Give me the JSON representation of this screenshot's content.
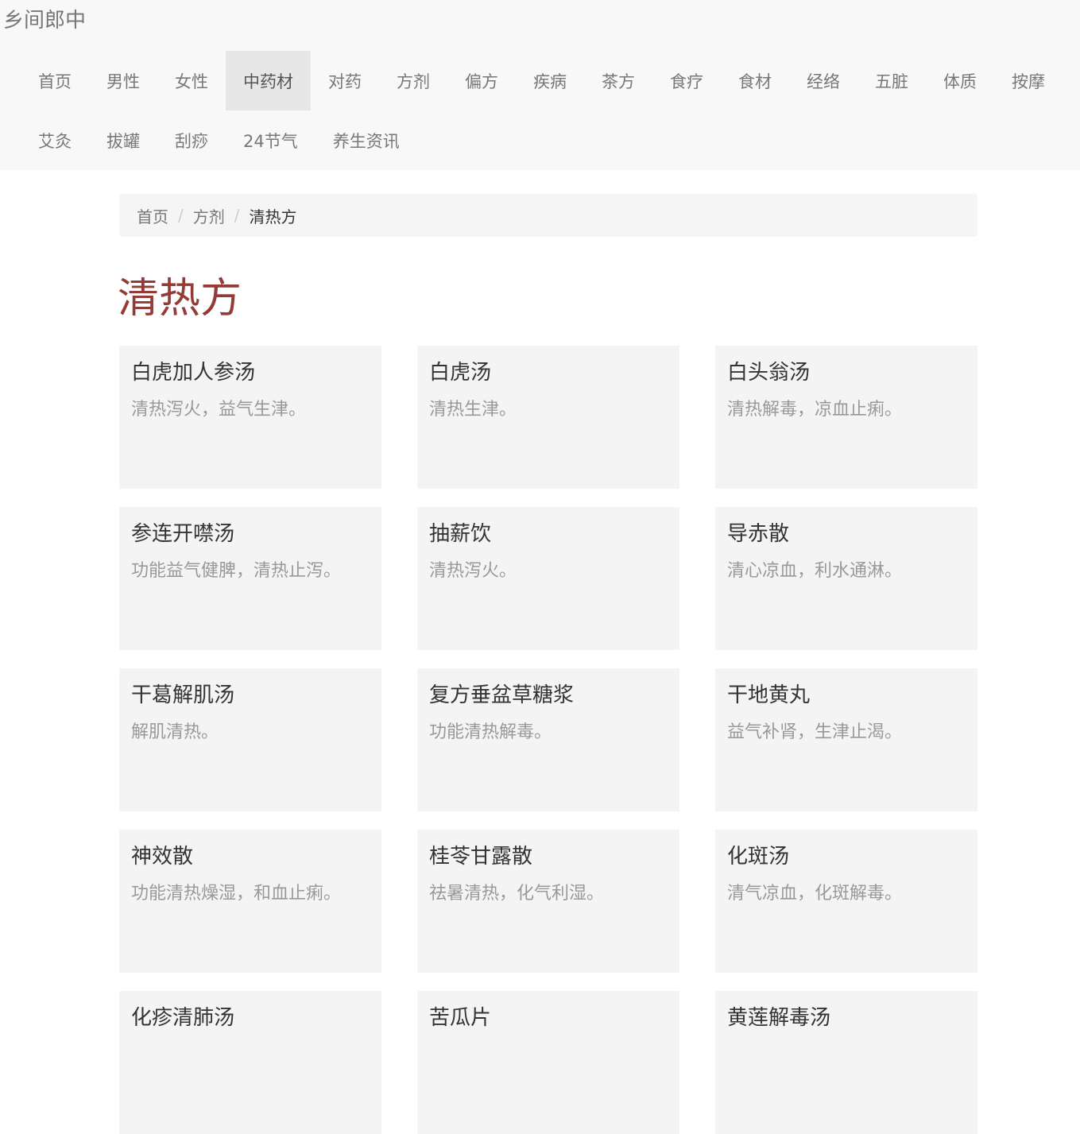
{
  "navbar": {
    "brand": "乡间郎中",
    "items": [
      {
        "label": "首页"
      },
      {
        "label": "男性"
      },
      {
        "label": "女性"
      },
      {
        "label": "中药材"
      },
      {
        "label": "对药"
      },
      {
        "label": "方剂"
      },
      {
        "label": "偏方"
      },
      {
        "label": "疾病"
      },
      {
        "label": "茶方"
      },
      {
        "label": "食疗"
      },
      {
        "label": "食材"
      },
      {
        "label": "经络"
      },
      {
        "label": "五脏"
      },
      {
        "label": "体质"
      },
      {
        "label": "按摩"
      },
      {
        "label": "艾灸"
      },
      {
        "label": "拔罐"
      },
      {
        "label": "刮痧"
      },
      {
        "label": "24节气"
      },
      {
        "label": "养生资讯"
      }
    ],
    "active_item": "中药材"
  },
  "breadcrumb": {
    "items": [
      "首页",
      "方剂"
    ],
    "separator": "/",
    "current": "清热方"
  },
  "page": {
    "title": "清热方"
  },
  "cards": [
    {
      "title": "白虎加人参汤",
      "desc": "清热泻火，益气生津。"
    },
    {
      "title": "白虎汤",
      "desc": "清热生津。"
    },
    {
      "title": "白头翁汤",
      "desc": "清热解毒，凉血止痢。"
    },
    {
      "title": "参连开噤汤",
      "desc": "功能益气健脾，清热止泻。"
    },
    {
      "title": "抽薪饮",
      "desc": "清热泻火。"
    },
    {
      "title": "导赤散",
      "desc": "清心凉血，利水通淋。"
    },
    {
      "title": "干葛解肌汤",
      "desc": "解肌清热。"
    },
    {
      "title": "复方垂盆草糖浆",
      "desc": "功能清热解毒。"
    },
    {
      "title": "干地黄丸",
      "desc": "益气补肾，生津止渴。"
    },
    {
      "title": "神效散",
      "desc": "功能清热燥湿，和血止痢。"
    },
    {
      "title": "桂苓甘露散",
      "desc": "祛暑清热，化气利湿。"
    },
    {
      "title": "化斑汤",
      "desc": "清气凉血，化斑解毒。"
    },
    {
      "title": "化疹清肺汤",
      "desc": ""
    },
    {
      "title": "苦瓜片",
      "desc": ""
    },
    {
      "title": "黄莲解毒汤",
      "desc": ""
    }
  ],
  "colors": {
    "navbar_bg": "#f8f8f8",
    "nav_active_bg": "#e7e7e7",
    "title_accent": "#953b37",
    "card_bg": "#f4f4f4",
    "muted_text": "#999999"
  }
}
